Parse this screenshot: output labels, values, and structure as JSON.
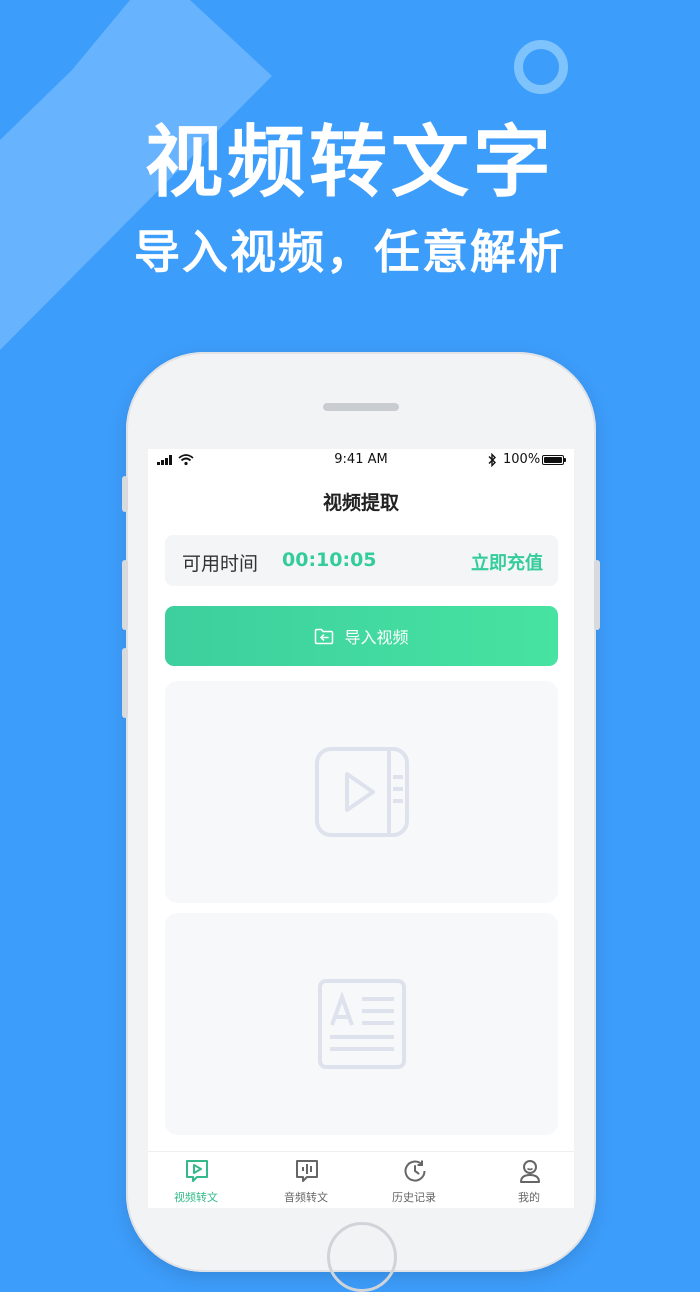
{
  "promo": {
    "headline": "视频转文字",
    "subheadline": "导入视频，任意解析"
  },
  "status_bar": {
    "time": "9:41 AM",
    "battery": "100%"
  },
  "nav": {
    "title": "视频提取"
  },
  "time_card": {
    "label": "可用时间",
    "value": "00:10:05",
    "recharge": "立即充值"
  },
  "import_button": {
    "label": "导入视频"
  },
  "tabs": [
    {
      "label": "视频转文",
      "icon": "video-text-icon",
      "active": true
    },
    {
      "label": "音频转文",
      "icon": "audio-text-icon",
      "active": false
    },
    {
      "label": "历史记录",
      "icon": "history-icon",
      "active": false
    },
    {
      "label": "我的",
      "icon": "profile-icon",
      "active": false
    }
  ],
  "colors": {
    "background": "#3d9dfb",
    "accent": "#34cc9b",
    "button_gradient_start": "#3dcf9e",
    "button_gradient_end": "#47e3a1",
    "placeholder_icon": "#dde2ec"
  }
}
